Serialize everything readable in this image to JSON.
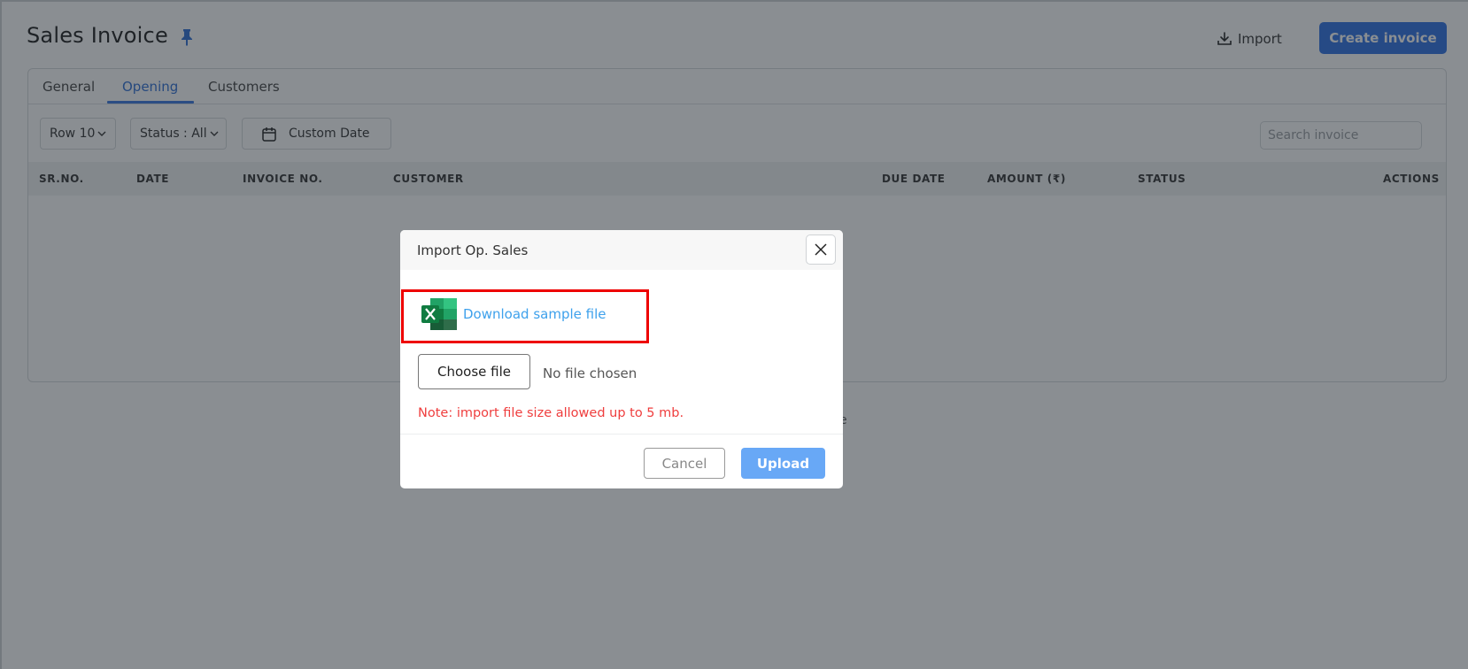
{
  "page": {
    "title": "Sales Invoice",
    "pin_icon": "pin-icon",
    "import_label": "Import",
    "import_icon": "download-tray-icon",
    "create_label": "Create invoice"
  },
  "tabs": [
    {
      "label": "General",
      "active": false
    },
    {
      "label": "Opening",
      "active": true
    },
    {
      "label": "Customers",
      "active": false
    }
  ],
  "filters": {
    "rows_label": "Row 10",
    "status_label": "Status : All",
    "date_label": "Custom Date",
    "search_placeholder": "Search invoice"
  },
  "table": {
    "columns": [
      "SR.NO.",
      "DATE",
      "INVOICE NO.",
      "CUSTOMER",
      "DUE DATE",
      "AMOUNT (₹)",
      "STATUS",
      "ACTIONS"
    ],
    "rows": [],
    "empty_fragment": "e"
  },
  "modal": {
    "title": "Import Op. Sales",
    "sample_link": "Download sample file",
    "choose_file_label": "Choose file",
    "file_status": "No file chosen",
    "note": "Note: import file size allowed up to 5 mb.",
    "cancel_label": "Cancel",
    "upload_label": "Upload"
  },
  "colors": {
    "primary": "#2f72e3",
    "link": "#3ea1ec",
    "note": "#ef3e3e",
    "highlight": "#ee0000",
    "upload": "#68a8f6"
  }
}
